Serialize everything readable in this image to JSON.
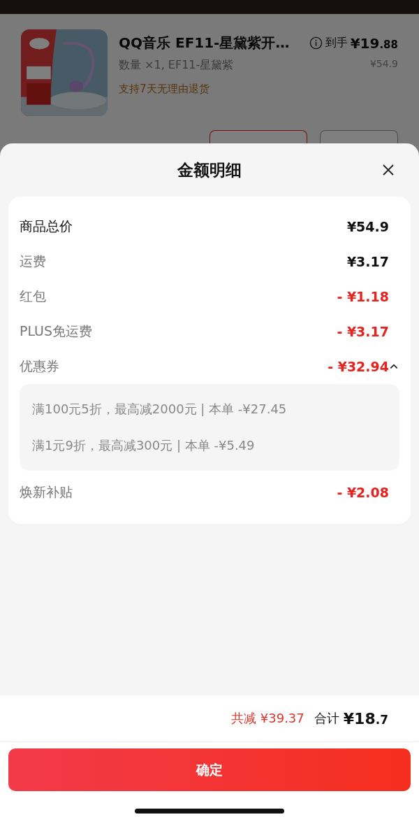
{
  "product": {
    "kind": "picture",
    "title": "QQ音乐 EF11-星黛紫开…",
    "spec": "数量 ×1, EF11-星黛紫",
    "return_policy": "支持7天无理由退货",
    "price_label": "到手",
    "price_integer": "¥19",
    "price_decimal": ".88",
    "original_price": "¥54.9",
    "buttons": [
      {
        "kind": "gift"
      },
      {
        "kind": "plain"
      }
    ]
  },
  "sheet": {
    "title": "金额明细",
    "rows": [
      {
        "label": "商品总价",
        "value": "¥54.9",
        "kind": "total"
      },
      {
        "label": "运费",
        "value": "¥3.17",
        "kind": "fee"
      },
      {
        "label": "红包",
        "value": "- ¥1.18",
        "kind": "discount"
      },
      {
        "label": "PLUS免运费",
        "value": "- ¥3.17",
        "kind": "discount"
      },
      {
        "label": "优惠券",
        "value": "- ¥32.94",
        "kind": "discount",
        "expanded": true,
        "details": [
          "满100元5折，最高减2000元 | 本单 -¥27.45",
          "满1元9折，最高减300元 | 本单 -¥5.49"
        ]
      },
      {
        "label": "焕新补贴",
        "value": "- ¥2.08",
        "kind": "discount"
      }
    ]
  },
  "footer": {
    "saved": "共减 ¥39.37",
    "total_label": "合计",
    "total_integer": "¥18",
    "total_decimal": ".7",
    "confirm": "确定"
  }
}
